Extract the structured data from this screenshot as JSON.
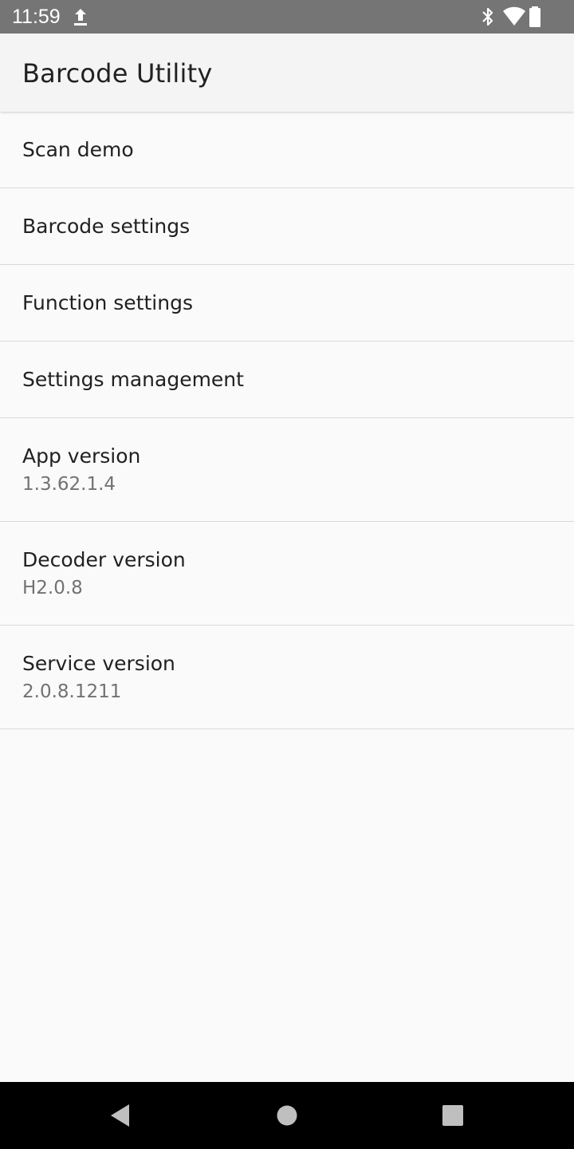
{
  "status_bar": {
    "time": "11:59",
    "icons": [
      "upload-icon",
      "bluetooth-icon",
      "wifi-icon",
      "battery-icon"
    ]
  },
  "app_bar": {
    "title": "Barcode Utility"
  },
  "menu": {
    "items": [
      {
        "title": "Scan demo"
      },
      {
        "title": "Barcode settings"
      },
      {
        "title": "Function settings"
      },
      {
        "title": "Settings management"
      },
      {
        "title": "App version",
        "summary": "1.3.62.1.4"
      },
      {
        "title": "Decoder version",
        "summary": "H2.0.8"
      },
      {
        "title": "Service version",
        "summary": "2.0.8.1211"
      }
    ]
  },
  "nav_bar": {
    "icons": [
      "back-icon",
      "home-icon",
      "recents-icon"
    ]
  },
  "colors": {
    "status_bar": "#757575",
    "app_bar": "#f4f4f4",
    "background": "#fafafa",
    "title_text": "#212121",
    "summary_text": "#727272",
    "divider": "#d9d9d9",
    "nav_bar": "#000000",
    "nav_icons": "#ffffff"
  }
}
